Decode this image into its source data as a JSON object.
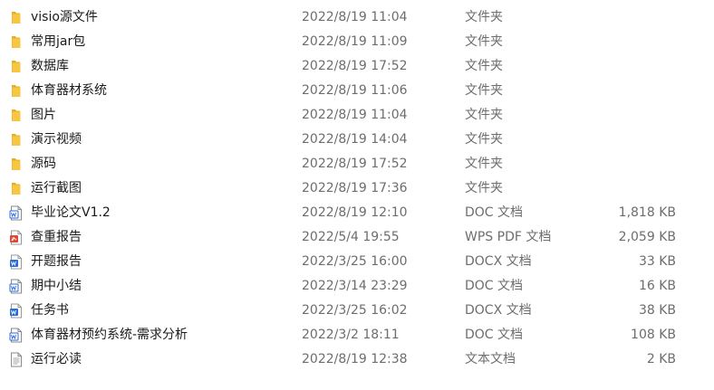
{
  "colors": {
    "folder": "#f7c744",
    "folder_dark": "#e8ad1c",
    "word_blue": "#2b6cd9",
    "pdf_red": "#e0483b",
    "text_gray": "#6d6d6d"
  },
  "files": [
    {
      "name": "visio源文件",
      "date": "2022/8/19 11:04",
      "type": "文件夹",
      "size": "",
      "icon": "folder-icon"
    },
    {
      "name": "常用jar包",
      "date": "2022/8/19 11:09",
      "type": "文件夹",
      "size": "",
      "icon": "folder-icon"
    },
    {
      "name": "数据库",
      "date": "2022/8/19 17:52",
      "type": "文件夹",
      "size": "",
      "icon": "folder-icon"
    },
    {
      "name": "体育器材系统",
      "date": "2022/8/19 11:06",
      "type": "文件夹",
      "size": "",
      "icon": "folder-icon"
    },
    {
      "name": "图片",
      "date": "2022/8/19 11:04",
      "type": "文件夹",
      "size": "",
      "icon": "folder-icon"
    },
    {
      "name": "演示视频",
      "date": "2022/8/19 14:04",
      "type": "文件夹",
      "size": "",
      "icon": "folder-icon"
    },
    {
      "name": "源码",
      "date": "2022/8/19 17:52",
      "type": "文件夹",
      "size": "",
      "icon": "folder-icon"
    },
    {
      "name": "运行截图",
      "date": "2022/8/19 17:36",
      "type": "文件夹",
      "size": "",
      "icon": "folder-icon"
    },
    {
      "name": "毕业论文V1.2",
      "date": "2022/8/19 12:10",
      "type": "DOC 文档",
      "size": "1,818 KB",
      "icon": "doc-file-icon"
    },
    {
      "name": "查重报告",
      "date": "2022/5/4 19:55",
      "type": "WPS PDF 文档",
      "size": "2,059 KB",
      "icon": "pdf-file-icon"
    },
    {
      "name": "开题报告",
      "date": "2022/3/25 16:00",
      "type": "DOCX 文档",
      "size": "33 KB",
      "icon": "docx-file-icon"
    },
    {
      "name": "期中小结",
      "date": "2022/3/14 23:29",
      "type": "DOC 文档",
      "size": "16 KB",
      "icon": "doc-file-icon"
    },
    {
      "name": "任务书",
      "date": "2022/3/25 16:02",
      "type": "DOCX 文档",
      "size": "38 KB",
      "icon": "docx-file-icon"
    },
    {
      "name": "体育器材预约系统-需求分析",
      "date": "2022/3/2 18:11",
      "type": "DOC 文档",
      "size": "108 KB",
      "icon": "doc-file-icon"
    },
    {
      "name": "运行必读",
      "date": "2022/8/19 12:38",
      "type": "文本文档",
      "size": "2 KB",
      "icon": "text-file-icon"
    }
  ]
}
